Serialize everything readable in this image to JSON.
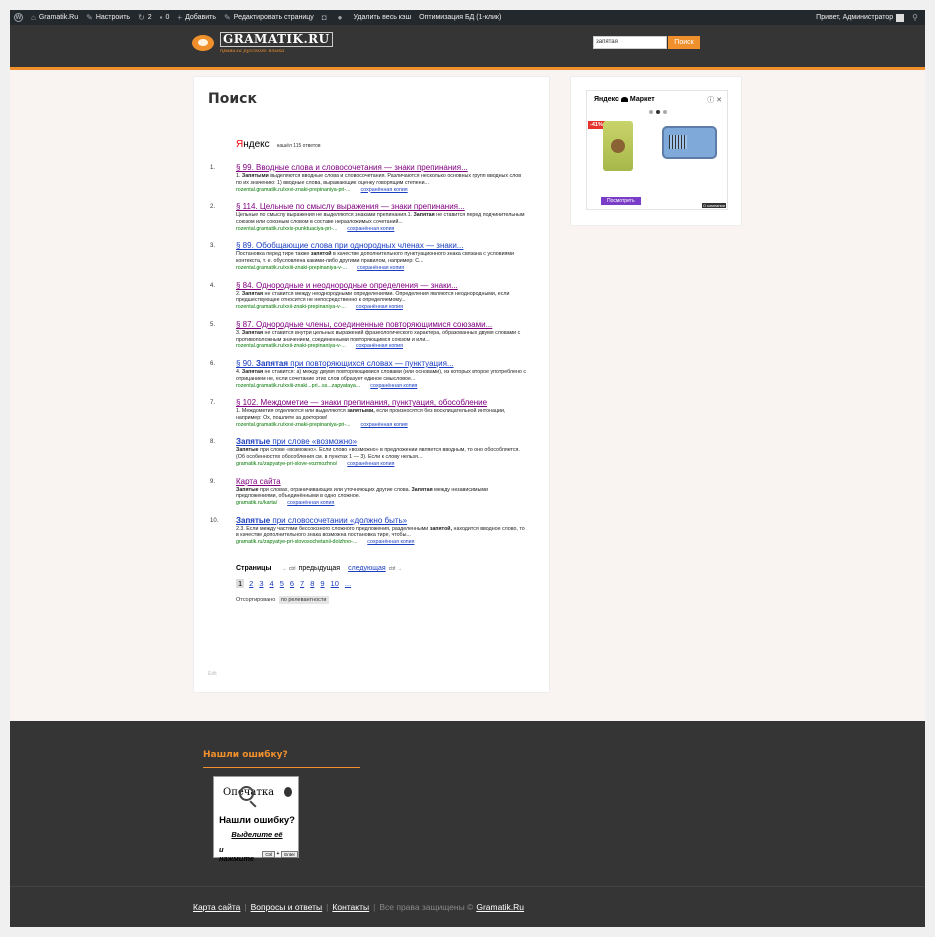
{
  "adminbar": {
    "site": "Gramatik.Ru",
    "customize": "Настроить",
    "updates_count": "2",
    "comments_count": "0",
    "add_new": "Добавить",
    "edit_page": "Редактировать страницу",
    "clear_cache": "Удалить весь кэш",
    "optimize_db": "Оптимизация БД (1-клик)",
    "greeting": "Привет, Администратор"
  },
  "header": {
    "logo_name": "GRAMATIK.RU",
    "logo_tagline": "правила русского языка",
    "search_value": "запятая",
    "search_button": "Поиск"
  },
  "main": {
    "title": "Поиск",
    "yandex_logo_first": "Я",
    "yandex_logo_rest": "ндекс",
    "found": "нашёл 115 ответов",
    "cache_label": "сохранённая копия",
    "results": [
      {
        "num": "1.",
        "title": "§ 99. Вводные слова и словосочетания — знаки препинания...",
        "snippet": "1. Запятыми выделяются вводные слова и словосочетания. Различаются несколько основных групп вводных слов по их значению: 1) вводные слова, выражающие оценку говорящим степени...",
        "url": "rozental.gramatik.ru/xxvi-znaki-prepinaniya-pri-..."
      },
      {
        "num": "2.",
        "title": "§ 114. Цельные по смыслу выражения — знаки препинания...",
        "snippet": "Цельные по смыслу выражения не выделяются знаками препинания.1. Запятая не ставится перед подчинительным союзом или союзным словом в составе неразложимых сочетаний...",
        "url": "rozental.gramatik.ru/xxix-punktuaciya-pri-..."
      },
      {
        "num": "3.",
        "title": "§ 89. Обобщающие слова при однородных членах — знаки...",
        "snippet": "Постановка перед тире также запятой в качестве дополнительного пунктуационного знака связана с условиями контекста, т. е. обусловлена какими-либо другими правилом, например: С...",
        "url": "rozental.gramatik.ru/xxiii-znaki-prepinaniya-v-..."
      },
      {
        "num": "4.",
        "title": "§ 84. Однородные и неоднородные определения — знаки...",
        "snippet": "2. Запятая не ставится между неоднородными определениями. Определения являются неоднородными, если предшествующее относится не непосредственно к определяемому...",
        "url": "rozental.gramatik.ru/xxii-znaki-prepinaniya-v-..."
      },
      {
        "num": "5.",
        "title": "§ 87. Однородные члены, соединенные повторяющимися союзами...",
        "snippet": "3. Запятая не ставится внутри цельных выражений фразеологического характера, образованных двумя словами с противоположным значением, соединенными повторяющимся союзом и или...",
        "url": "rozental.gramatik.ru/xxii-znaki-prepinaniya-v-..."
      },
      {
        "num": "6.",
        "title": "§ 90. Запятая при повторяющихся словах — пунктуация...",
        "snippet": "4. Запятая не ставится: а) между двумя повторяющимися словами (или основами), из которых второе употреблено с отрицанием не, если сочетание этих слов образует единое смысловое...",
        "url": "rozental.gramatik.ru/xxiii-znaki...pri...ss...zapyataya..."
      },
      {
        "num": "7.",
        "title": "§ 102. Междометие — знаки препинания, пунктуация, обособление",
        "snippet": "1. Междометия отделяются или выделяются запятыми, если произносятся без восклицательной интонации, например: Ох, пошлите за доктором!",
        "url": "rozental.gramatik.ru/xxvi-znaki-prepinaniya-pri-..."
      },
      {
        "num": "8.",
        "title": "Запятые при слове «возможно»",
        "snippet": "Запятые при слове «возможно». Если слово «возможно» в предложении является вводным, то оно обособляется. (Об особенностях обособления см. в пунктах 1 — 3). Если к слову нельзя...",
        "url": "gramatik.ru/zapyatye-pri-slove-vozmozhno/"
      },
      {
        "num": "9.",
        "title": "Карта сайта",
        "snippet": "Запятые при словах, ограничивающих или уточняющих другие слова. Запятая между независимыми предложениями, объединёнными в одно сложное.",
        "url": "gramatik.ru/karta/"
      },
      {
        "num": "10.",
        "title": "Запятые при словосочетании «должно быть»",
        "snippet": "2.3. Если между частями бессоюзного сложного предложения, разделенными запятой, находится вводное слово, то в качестве дополнительного знака возможна постановка тире, чтобы...",
        "url": "gramatik.ru/zapyatye-pri-slovosochetanii-dolzhno-..."
      }
    ],
    "pager_label": "Страницы",
    "ctrl_left": "← ctrl",
    "prev": "предыдущая",
    "next": "следующая",
    "ctrl_right": "ctrl →",
    "pages": [
      "1",
      "2",
      "3",
      "4",
      "5",
      "6",
      "7",
      "8",
      "9",
      "10",
      "..."
    ],
    "sorted_label": "Отсортировано",
    "sorted_value": "по релевантности",
    "edit": "Edit"
  },
  "sidebar_ad": {
    "brand_a": "Яндекс",
    "brand_b": "Маркет",
    "discount": "-41%",
    "button": "Посмотреть",
    "info": "О компании",
    "ctrl": "ⓘ ✕"
  },
  "footer": {
    "title": "Нашли ошибку?",
    "oops_title": "Опечатка",
    "oops_question": "Нашли ошибку?",
    "oops_select": "Выделите её",
    "oops_press": "и нажмите",
    "key_ctrl": "Ctrl",
    "key_enter": "Enter",
    "plus": "+",
    "links": [
      "Карта сайта",
      "Вопросы и ответы",
      "Контакты"
    ],
    "copyright": "Все права защищены ©",
    "site_link": "Gramatik.Ru"
  }
}
